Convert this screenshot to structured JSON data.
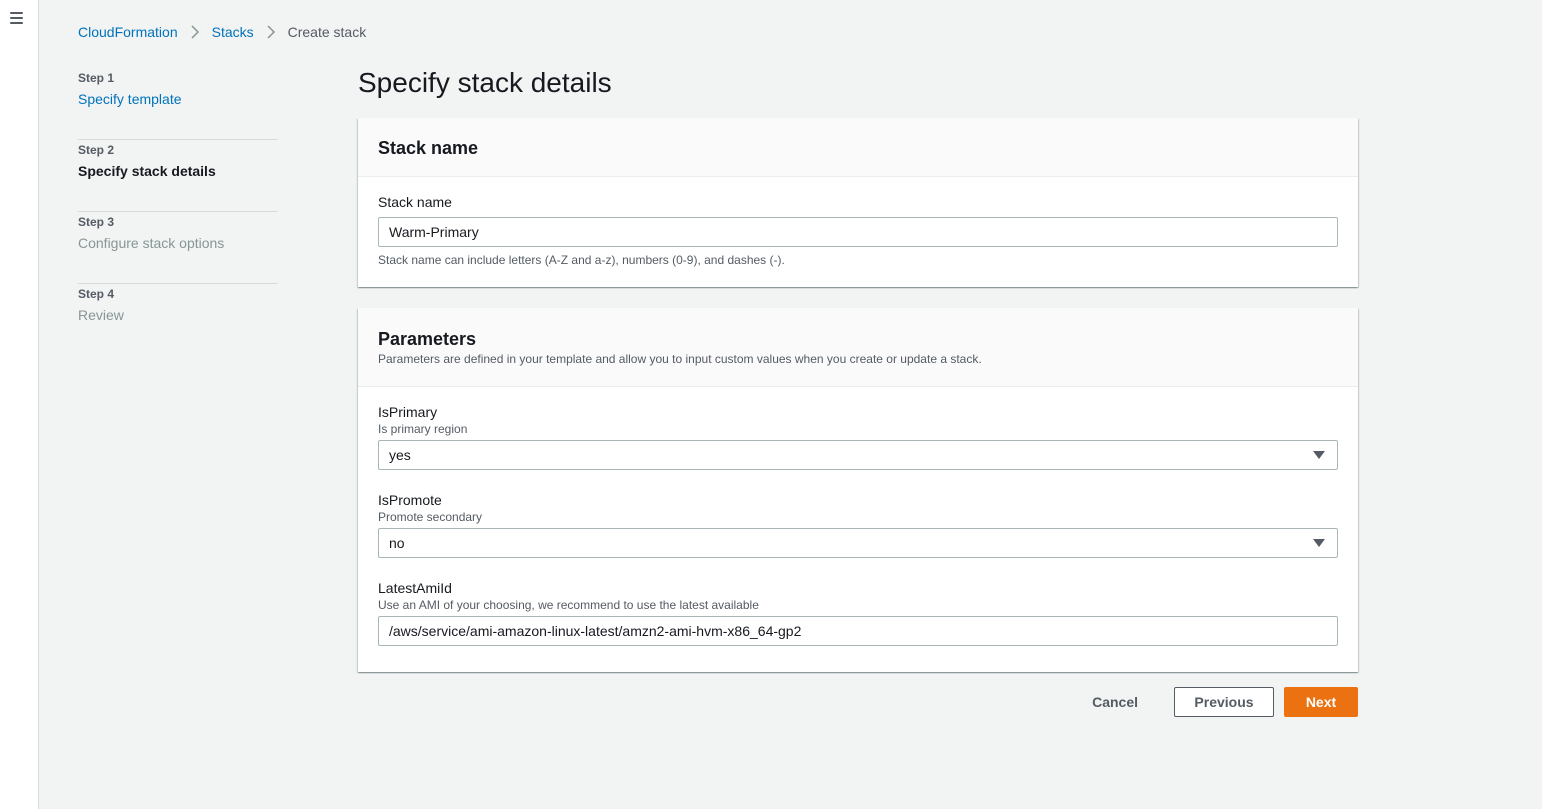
{
  "breadcrumb": {
    "items": [
      "CloudFormation",
      "Stacks"
    ],
    "current": "Create stack"
  },
  "steps": [
    {
      "num": "Step 1",
      "title": "Specify template",
      "state": "link"
    },
    {
      "num": "Step 2",
      "title": "Specify stack details",
      "state": "active"
    },
    {
      "num": "Step 3",
      "title": "Configure stack options",
      "state": "disabled"
    },
    {
      "num": "Step 4",
      "title": "Review",
      "state": "disabled"
    }
  ],
  "page_title": "Specify stack details",
  "stack_name_section": {
    "header": "Stack name",
    "label": "Stack name",
    "value": "Warm-Primary",
    "constraint": "Stack name can include letters (A-Z and a-z), numbers (0-9), and dashes (-)."
  },
  "parameters_section": {
    "header": "Parameters",
    "description": "Parameters are defined in your template and allow you to input custom values when you create or update a stack.",
    "params": [
      {
        "label": "IsPrimary",
        "description": "Is primary region",
        "type": "select",
        "value": "yes"
      },
      {
        "label": "IsPromote",
        "description": "Promote secondary",
        "type": "select",
        "value": "no"
      },
      {
        "label": "LatestAmiId",
        "description": "Use an AMI of your choosing, we recommend to use the latest available",
        "type": "text",
        "value": "/aws/service/ami-amazon-linux-latest/amzn2-ami-hvm-x86_64-gp2"
      }
    ]
  },
  "actions": {
    "cancel": "Cancel",
    "previous": "Previous",
    "next": "Next"
  },
  "colors": {
    "link": "#0073bb",
    "primary_button": "#ec7211",
    "background": "#f2f3f3"
  }
}
